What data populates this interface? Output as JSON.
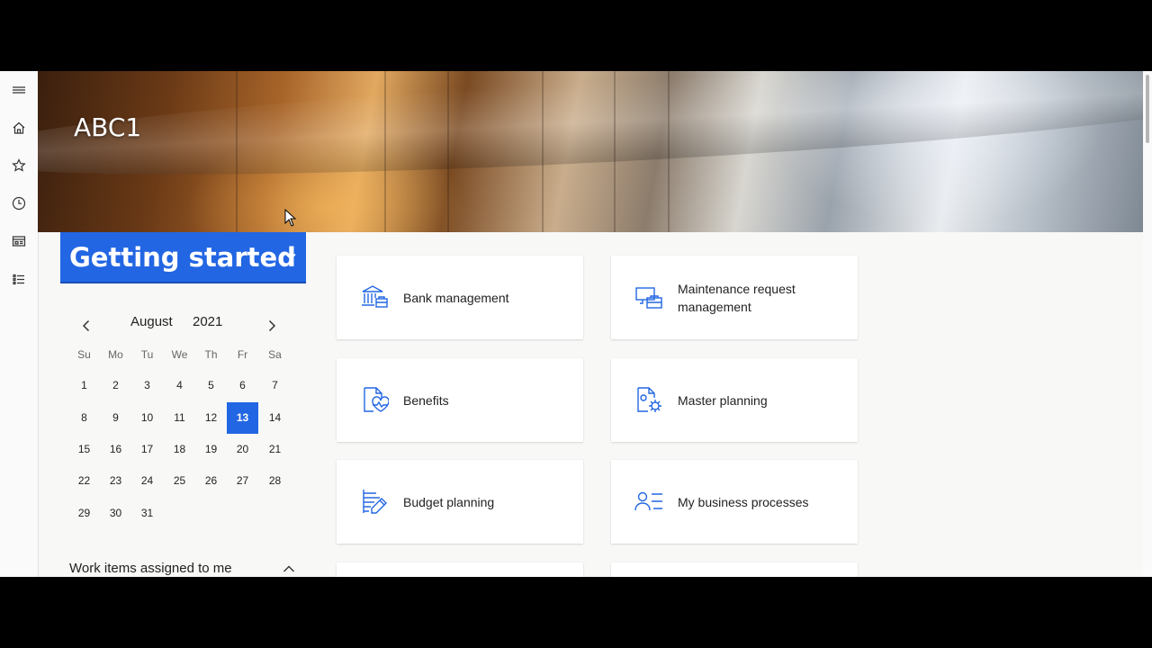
{
  "banner": {
    "title": "ABC1"
  },
  "workspace": {
    "title": "Getting started"
  },
  "calendar": {
    "month": "August",
    "year": "2021",
    "weekdays": [
      "Su",
      "Mo",
      "Tu",
      "We",
      "Th",
      "Fr",
      "Sa"
    ],
    "weeks": [
      [
        "1",
        "2",
        "3",
        "4",
        "5",
        "6",
        "7"
      ],
      [
        "8",
        "9",
        "10",
        "11",
        "12",
        "13",
        "14"
      ],
      [
        "15",
        "16",
        "17",
        "18",
        "19",
        "20",
        "21"
      ],
      [
        "22",
        "23",
        "24",
        "25",
        "26",
        "27",
        "28"
      ],
      [
        "29",
        "30",
        "31",
        "",
        "",
        "",
        ""
      ]
    ],
    "selected": "13"
  },
  "work_items": {
    "label": "Work items assigned to me"
  },
  "tiles": [
    {
      "label": "Bank management",
      "icon": "bank-icon"
    },
    {
      "label": "Maintenance request management",
      "icon": "maintenance-icon"
    },
    {
      "label": "Benefits",
      "icon": "benefits-icon"
    },
    {
      "label": "Master planning",
      "icon": "planning-gear-icon"
    },
    {
      "label": "Budget planning",
      "icon": "budget-icon"
    },
    {
      "label": "My business processes",
      "icon": "business-process-icon"
    }
  ],
  "colors": {
    "accent": "#2266e3",
    "background": "#f8f8f7"
  }
}
